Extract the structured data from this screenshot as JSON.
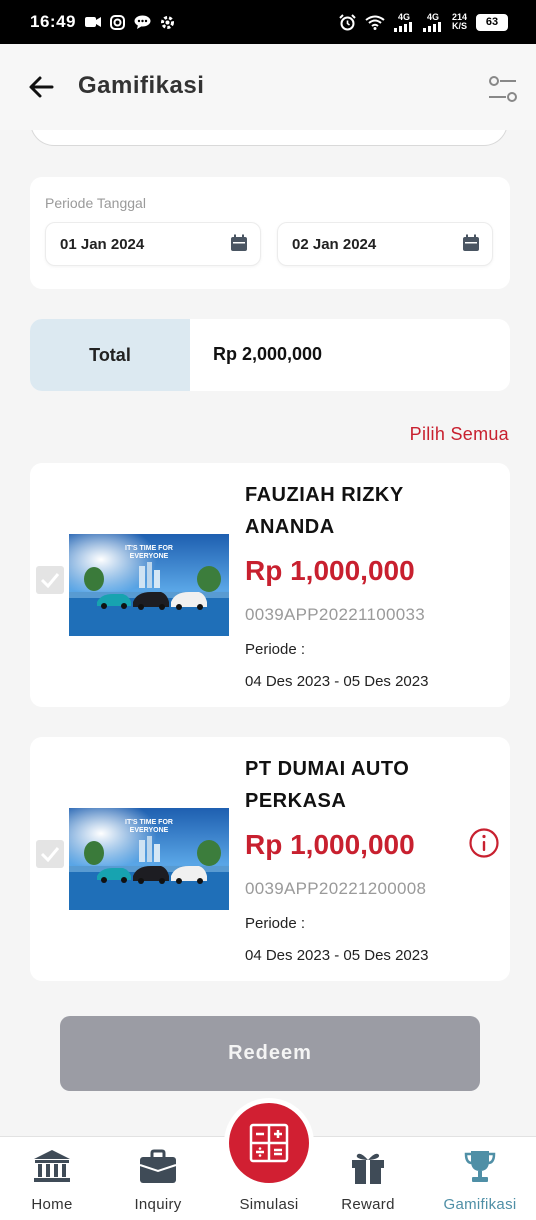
{
  "status_bar": {
    "time": "16:49",
    "net_speed_top": "214",
    "net_speed_bottom": "K/S",
    "net1": "4G",
    "net2": "4G",
    "battery": "63"
  },
  "header": {
    "title": "Gamifikasi"
  },
  "periode": {
    "label": "Periode Tanggal",
    "start_date": "01 Jan 2024",
    "end_date": "02 Jan 2024"
  },
  "total": {
    "label": "Total",
    "value": "Rp 2,000,000"
  },
  "select_all_label": "Pilih Semua",
  "vouchers": [
    {
      "name": "FAUZIAH RIZKY ANANDA",
      "amount": "Rp 1,000,000",
      "code": "0039APP20221100033",
      "periode_label": "Periode :",
      "periode": "04 Des 2023 - 05 Des 2023",
      "checked": true,
      "banner_line1": "IT'S TIME FOR",
      "banner_line2": "EVERYONE"
    },
    {
      "name": "PT DUMAI AUTO PERKASA",
      "amount": "Rp 1,000,000",
      "code": "0039APP20221200008",
      "periode_label": "Periode :",
      "periode": "04 Des 2023 - 05 Des 2023",
      "checked": true,
      "banner_line1": "IT'S TIME FOR",
      "banner_line2": "EVERYONE"
    }
  ],
  "redeem_label": "Redeem",
  "nav": [
    {
      "label": "Home",
      "icon": "bank-icon",
      "active": false
    },
    {
      "label": "Inquiry",
      "icon": "briefcase-icon",
      "active": false
    },
    {
      "label": "Simulasi",
      "icon": "calculator-icon",
      "active": false
    },
    {
      "label": "Reward",
      "icon": "gift-icon",
      "active": false
    },
    {
      "label": "Gamifikasi",
      "icon": "trophy-icon",
      "active": true
    }
  ],
  "colors": {
    "accent_red": "#c8202f",
    "active_nav": "#4f8fa6",
    "total_bg": "#dce9f1",
    "redeem_disabled": "#9b9ca4"
  }
}
